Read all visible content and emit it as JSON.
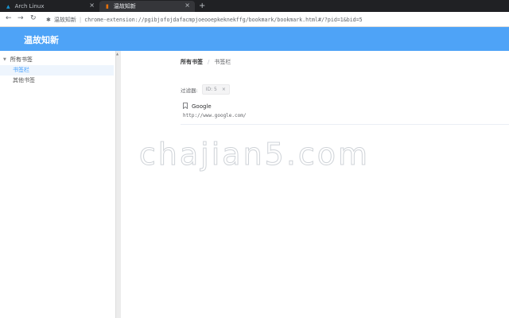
{
  "browser": {
    "tabs": [
      {
        "title": "Arch Linux",
        "icon": "arch-linux-icon"
      },
      {
        "title": "温故知新",
        "icon": "extension-page-icon"
      }
    ],
    "omnibox": {
      "site_name": "温故知新",
      "separator": "|",
      "url": "chrome-extension://pgibjofojdafacmpjoeooepkeknekffg/bookmark/bookmark.html#/?pid=1&bid=5"
    }
  },
  "app": {
    "title": "温故知新"
  },
  "sidebar": {
    "root_label": "所有书签",
    "items": [
      {
        "label": "书签栏",
        "active": true
      },
      {
        "label": "其他书签",
        "active": false
      }
    ]
  },
  "main": {
    "breadcrumb": [
      "所有书签",
      "书签栏"
    ],
    "breadcrumb_separator": "/",
    "filter": {
      "label": "过滤器:",
      "tag": "ID: 5"
    },
    "bookmarks": [
      {
        "title": "Google",
        "url": "http://www.google.com/"
      }
    ]
  },
  "watermark": "chajian5.com",
  "colors": {
    "header": "#4ea3f7",
    "active_item": "#409eff",
    "tab_strip": "#202124"
  }
}
